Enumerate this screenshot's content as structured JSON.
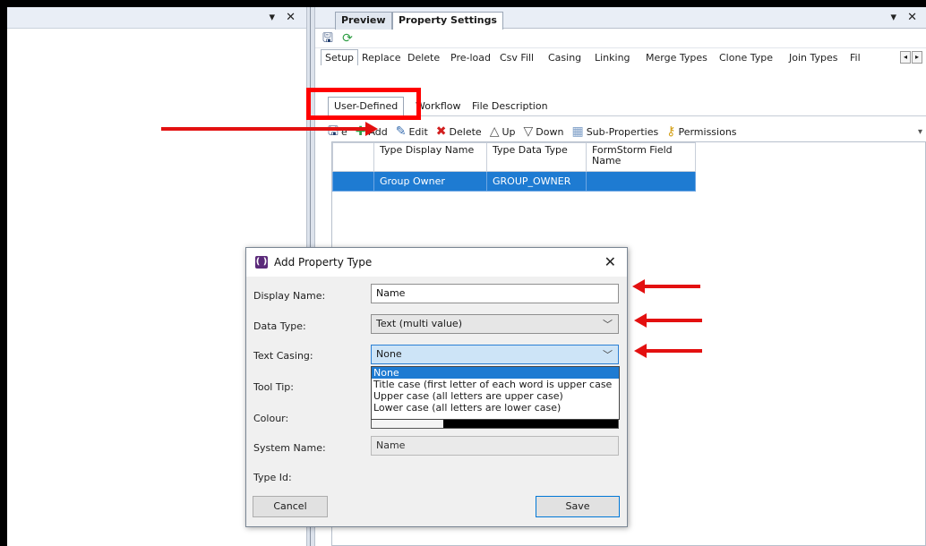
{
  "left_pane": {
    "controls": "▾ ✕"
  },
  "right_pane": {
    "controls": "▾ ✕",
    "doc_tabs": [
      "Preview",
      "Property Settings"
    ],
    "setup_tabs": [
      "Setup",
      "Replace",
      "Delete",
      "Pre-load",
      "Csv Fill",
      "Casing",
      "Linking",
      "Merge Types",
      "Clone Type",
      "Join Types",
      "Fil"
    ],
    "sub_tabs": [
      "User-Defined",
      "Workflow",
      "File Description"
    ],
    "actions": [
      "e",
      "Add",
      "Edit",
      "Delete",
      "Up",
      "Down",
      "Sub-Properties",
      "Permissions"
    ],
    "grid": {
      "headers": [
        "Type Display Name",
        "Type Data Type",
        "FormStorm Field Name"
      ],
      "rows": [
        [
          "Group Owner",
          "GROUP_OWNER",
          ""
        ]
      ]
    }
  },
  "dialog": {
    "title": "Add Property Type",
    "close": "✕",
    "labels": {
      "display_name": "Display Name:",
      "data_type": "Data Type:",
      "text_casing": "Text Casing:",
      "tool_tip": "Tool Tip:",
      "colour": "Colour:",
      "system_name": "System Name:",
      "type_id": "Type Id:"
    },
    "values": {
      "display_name": "Name",
      "data_type": "Text (multi value)",
      "text_casing": "None",
      "system_name": "Name"
    },
    "casing_options": [
      "None",
      "Title case (first letter of each word is upper case",
      "Upper case (all letters are upper case)",
      "Lower case (all letters are lower case)"
    ],
    "buttons": {
      "cancel": "Cancel",
      "save": "Save"
    }
  },
  "colors": {
    "selection": "#1e7bd2",
    "annotation": "#e31010"
  }
}
